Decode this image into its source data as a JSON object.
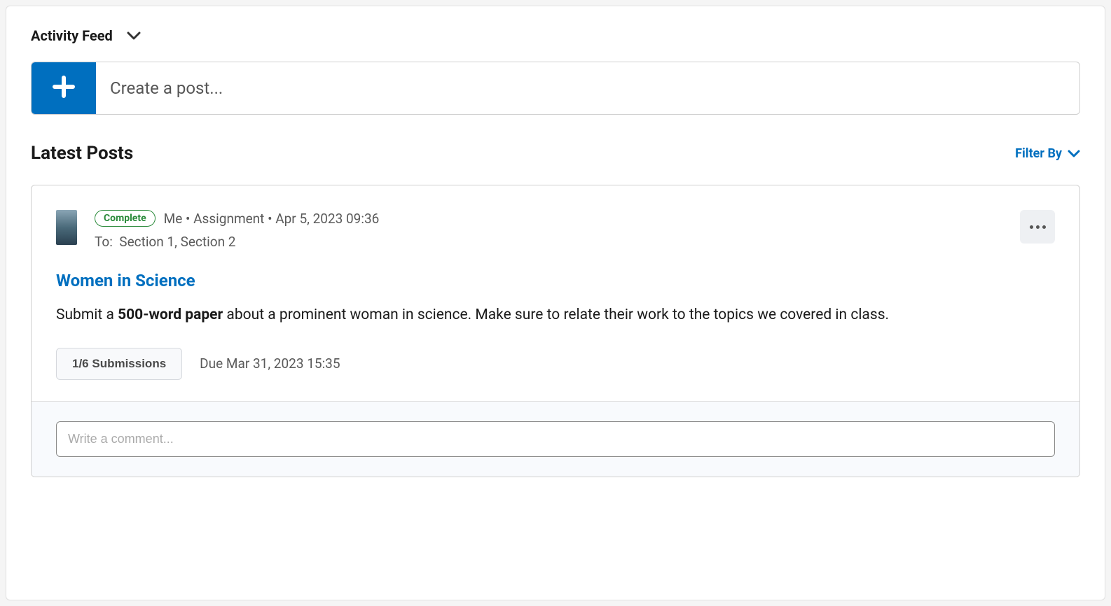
{
  "header": {
    "title": "Activity Feed"
  },
  "createPost": {
    "placeholder": "Create a post..."
  },
  "section": {
    "title": "Latest Posts",
    "filterLabel": "Filter By"
  },
  "post": {
    "badge": "Complete",
    "author": "Me",
    "type": "Assignment",
    "date": "Apr 5, 2023 09:36",
    "metaSeparator": "  •  ",
    "toLabel": "To:",
    "toValue": "Section 1, Section 2",
    "title": "Women in Science",
    "body_prefix": "Submit a ",
    "body_bold": "500-word paper",
    "body_suffix": " about a prominent woman in science. Make sure to relate their work to the topics we covered in class.",
    "submissionsLabel": "1/6 Submissions",
    "dueLabel": "Due Mar 31, 2023 15:35"
  },
  "comment": {
    "placeholder": "Write a comment..."
  }
}
